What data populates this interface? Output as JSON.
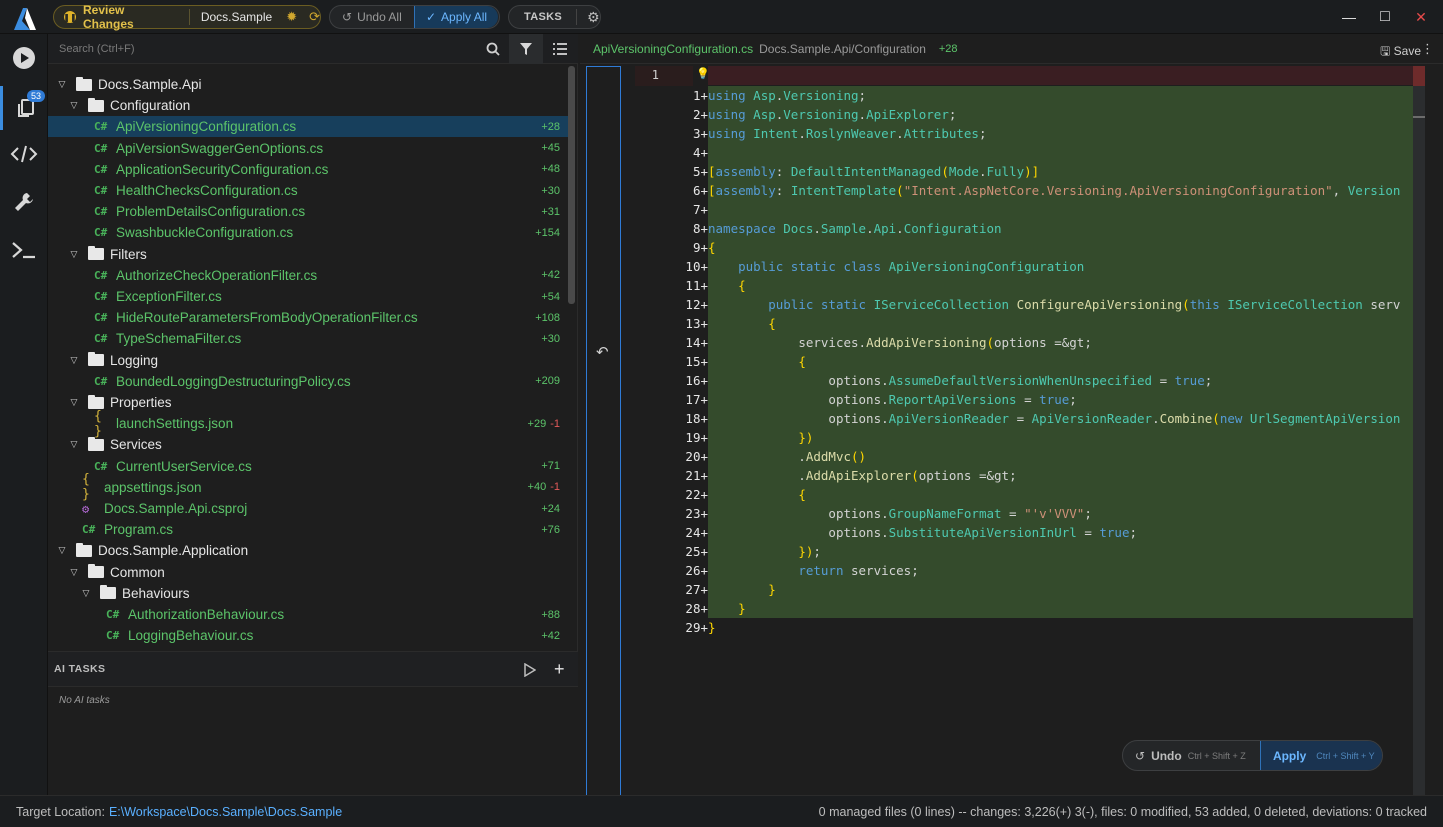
{
  "titlebar": {
    "review_label": "Review Changes",
    "project": "Docs.Sample",
    "undo_all": "Undo All",
    "apply_all": "Apply All",
    "tasks": "TASKS",
    "minimize": "—",
    "maximize": "□",
    "close": "✕"
  },
  "activity": {
    "changes_badge": "53"
  },
  "sidebar": {
    "search_placeholder": "Search (Ctrl+F)",
    "tree": [
      {
        "type": "folder",
        "name": "Docs.Sample.Api",
        "depth": 0,
        "count": ""
      },
      {
        "type": "folder",
        "name": "Configuration",
        "depth": 1,
        "count": ""
      },
      {
        "type": "cs",
        "name": "ApiVersioningConfiguration.cs",
        "depth": 2,
        "count": "+28",
        "selected": true
      },
      {
        "type": "cs",
        "name": "ApiVersionSwaggerGenOptions.cs",
        "depth": 2,
        "count": "+45"
      },
      {
        "type": "cs",
        "name": "ApplicationSecurityConfiguration.cs",
        "depth": 2,
        "count": "+48"
      },
      {
        "type": "cs",
        "name": "HealthChecksConfiguration.cs",
        "depth": 2,
        "count": "+30"
      },
      {
        "type": "cs",
        "name": "ProblemDetailsConfiguration.cs",
        "depth": 2,
        "count": "+31"
      },
      {
        "type": "cs",
        "name": "SwashbuckleConfiguration.cs",
        "depth": 2,
        "count": "+154"
      },
      {
        "type": "folder",
        "name": "Filters",
        "depth": 1,
        "count": ""
      },
      {
        "type": "cs",
        "name": "AuthorizeCheckOperationFilter.cs",
        "depth": 2,
        "count": "+42"
      },
      {
        "type": "cs",
        "name": "ExceptionFilter.cs",
        "depth": 2,
        "count": "+54"
      },
      {
        "type": "cs",
        "name": "HideRouteParametersFromBodyOperationFilter.cs",
        "depth": 2,
        "count": "+108"
      },
      {
        "type": "cs",
        "name": "TypeSchemaFilter.cs",
        "depth": 2,
        "count": "+30"
      },
      {
        "type": "folder",
        "name": "Logging",
        "depth": 1,
        "count": ""
      },
      {
        "type": "cs",
        "name": "BoundedLoggingDestructuringPolicy.cs",
        "depth": 2,
        "count": "+209"
      },
      {
        "type": "folder",
        "name": "Properties",
        "depth": 1,
        "count": ""
      },
      {
        "type": "json",
        "name": "launchSettings.json",
        "depth": 2,
        "count": "+29",
        "neg": "-1"
      },
      {
        "type": "folder",
        "name": "Services",
        "depth": 1,
        "count": ""
      },
      {
        "type": "cs",
        "name": "CurrentUserService.cs",
        "depth": 2,
        "count": "+71"
      },
      {
        "type": "json",
        "name": "appsettings.json",
        "depth": 1,
        "count": "+40",
        "neg": "-1"
      },
      {
        "type": "proj",
        "name": "Docs.Sample.Api.csproj",
        "depth": 1,
        "count": "+24"
      },
      {
        "type": "cs",
        "name": "Program.cs",
        "depth": 1,
        "count": "+76"
      },
      {
        "type": "folder",
        "name": "Docs.Sample.Application",
        "depth": 0,
        "count": ""
      },
      {
        "type": "folder",
        "name": "Common",
        "depth": 1,
        "count": ""
      },
      {
        "type": "folder",
        "name": "Behaviours",
        "depth": 2,
        "count": ""
      },
      {
        "type": "cs",
        "name": "AuthorizationBehaviour.cs",
        "depth": 3,
        "count": "+88"
      },
      {
        "type": "cs",
        "name": "LoggingBehaviour.cs",
        "depth": 3,
        "count": "+42"
      }
    ],
    "ai_tasks_title": "AI TASKS",
    "ai_tasks_empty": "No AI tasks"
  },
  "editor": {
    "filename": "ApiVersioningConfiguration.cs",
    "path": "Docs.Sample.Api/Configuration",
    "added": "+28",
    "save": "Save",
    "left_line_number": "1",
    "code_lines": [
      "using Asp.Versioning;",
      "using Asp.Versioning.ApiExplorer;",
      "using Intent.RoslynWeaver.Attributes;",
      "",
      "[assembly: DefaultIntentManaged(Mode.Fully)]",
      "[assembly: IntentTemplate(\"Intent.AspNetCore.Versioning.ApiVersioningConfiguration\", Version",
      "",
      "namespace Docs.Sample.Api.Configuration",
      "{",
      "    public static class ApiVersioningConfiguration",
      "    {",
      "        public static IServiceCollection ConfigureApiVersioning(this IServiceCollection serv",
      "        {",
      "            services.AddApiVersioning(options =>",
      "            {",
      "                options.AssumeDefaultVersionWhenUnspecified = true;",
      "                options.ReportApiVersions = true;",
      "                options.ApiVersionReader = ApiVersionReader.Combine(new UrlSegmentApiVersion",
      "            })",
      "            .AddMvc()",
      "            .AddApiExplorer(options =>",
      "            {",
      "                options.GroupNameFormat = \"'v'VVV\";",
      "                options.SubstituteApiVersionInUrl = true;",
      "            });",
      "            return services;",
      "        }",
      "    }",
      "}"
    ],
    "undo_label": "Undo",
    "undo_shortcut": "Ctrl + Shift + Z",
    "apply_label": "Apply",
    "apply_shortcut": "Ctrl + Shift + Y"
  },
  "status": {
    "target_label": "Target Location:",
    "target_path": "E:\\Workspace\\Docs.Sample\\Docs.Sample",
    "summary": "0 managed files (0 lines) -- changes: 3,226(+) 3(-), files: 0 modified, 53 added, 0 deleted, deviations: 0 tracked"
  },
  "colors": {
    "added_bg": "#344b2c",
    "accent": "#2f7bd6",
    "review": "#e2c14a",
    "added_text": "#5cc46a",
    "removed_text": "#e35a5a"
  }
}
